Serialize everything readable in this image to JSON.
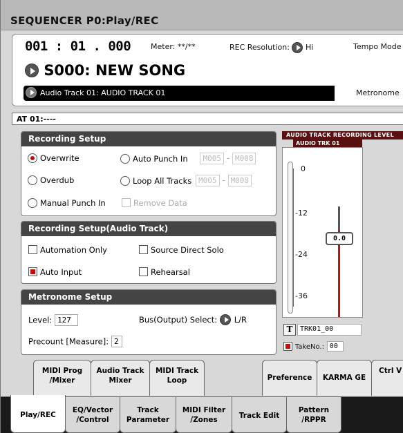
{
  "header": {
    "title": "SEQUENCER P0:Play/REC"
  },
  "locator": {
    "position": "001 : 01 . 000",
    "meter_label": "Meter:",
    "meter_value": "**/**",
    "rec_res_label": "REC Resolution:",
    "rec_res_value": "Hi",
    "tempo_label": "Tempo Mode"
  },
  "song": {
    "name": "S000: NEW SONG"
  },
  "track": {
    "select_label": "Audio Track 01: AUDIO TRACK 01",
    "metronome_label": "Metronome"
  },
  "at_line": "AT 01:----",
  "recording_setup": {
    "title": "Recording Setup",
    "overwrite": "Overwrite",
    "overdub": "Overdub",
    "manual_punch": "Manual Punch In",
    "auto_punch": "Auto Punch In",
    "loop_all": "Loop All Tracks",
    "remove_data": "Remove Data",
    "punch_start": "M005",
    "punch_end": "M008",
    "loop_start": "M005",
    "loop_end": "M008",
    "dash": "-"
  },
  "audio_setup": {
    "title": "Recording Setup(Audio Track)",
    "automation_only": "Automation Only",
    "source_direct_solo": "Source Direct Solo",
    "auto_input": "Auto Input",
    "rehearsal": "Rehearsal"
  },
  "metronome": {
    "title": "Metronome Setup",
    "level_label": "Level:",
    "level_value": "127",
    "bus_label": "Bus(Output) Select:",
    "bus_value": "L/R",
    "precount_label": "Precount [Measure]:",
    "precount_value": "2"
  },
  "meter_panel": {
    "header": "AUDIO TRACK RECORDING LEVEL",
    "track": "AUDIO TRK 01",
    "scale": [
      "0",
      "-12",
      "-24",
      "-36"
    ],
    "fader_value": "0.0",
    "filename": "TRK01_00",
    "take_label": "TakeNo.:",
    "take_value": "00",
    "t_button": "T",
    "fader_level": 0.78,
    "accent": "#c01010"
  },
  "top_tabs": [
    {
      "label": "MIDI Prog /Mixer"
    },
    {
      "label": "Audio Track Mixer"
    },
    {
      "label": "MIDI Track Loop"
    },
    {
      "label": "Preference"
    },
    {
      "label": "KARMA GE"
    },
    {
      "label": "Ctrl V /Eff"
    }
  ],
  "bottom_tabs": [
    {
      "label": "Play/REC"
    },
    {
      "label": "EQ/Vector /Control"
    },
    {
      "label": "Track Parameter"
    },
    {
      "label": "MIDI Filter /Zones"
    },
    {
      "label": "Track Edit"
    },
    {
      "label": "Pattern /RPPR"
    }
  ]
}
